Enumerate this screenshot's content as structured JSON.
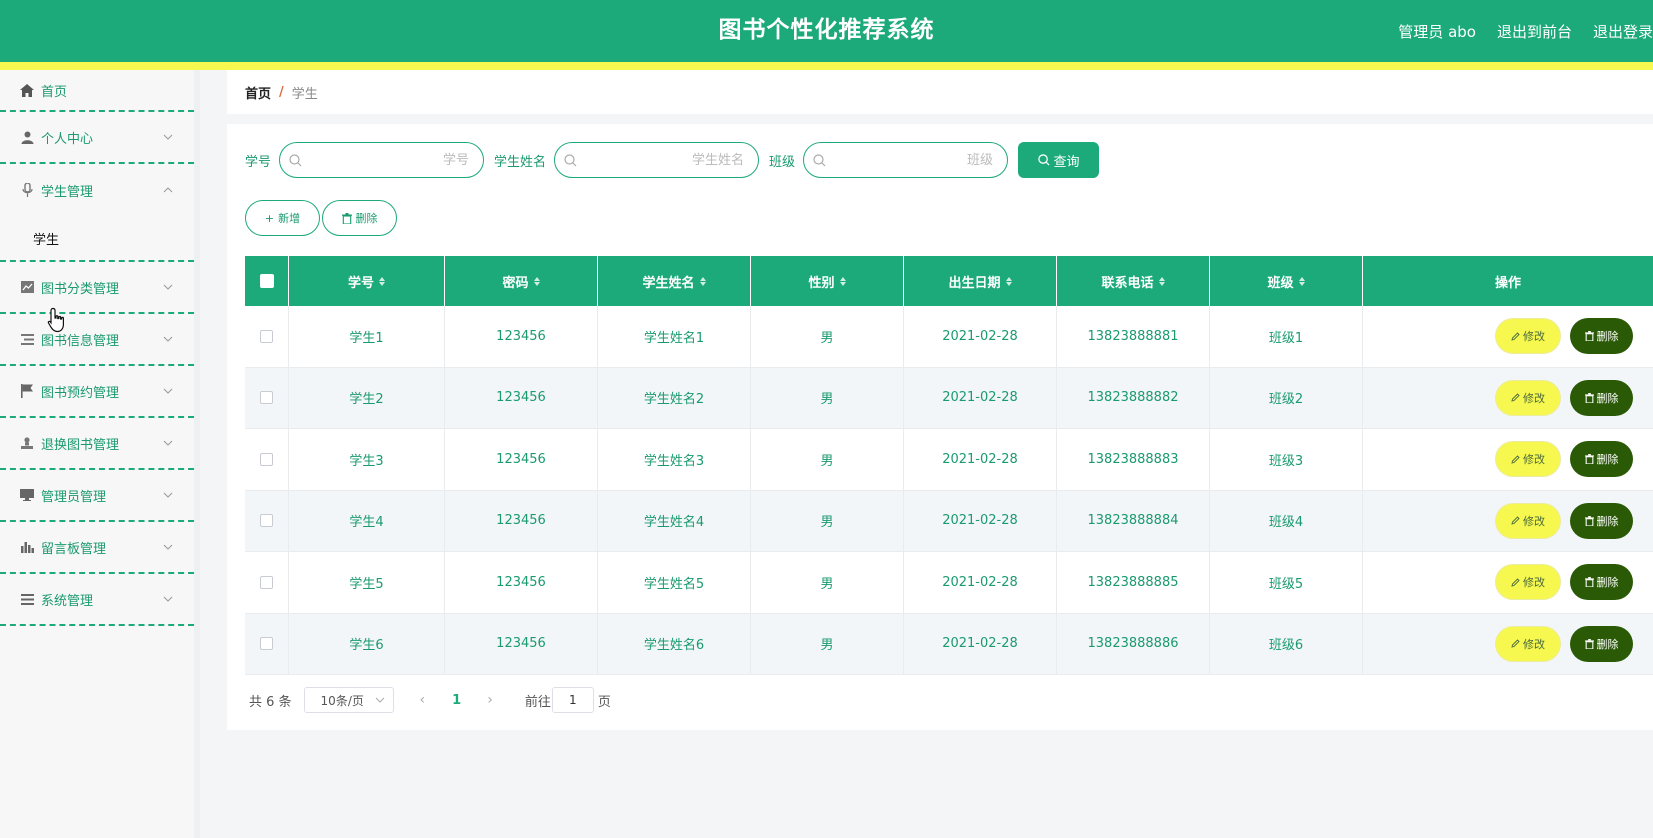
{
  "header": {
    "title": "图书个性化推荐系统",
    "user": "管理员 abo",
    "front_link": "退出到前台",
    "logout_link": "退出登录"
  },
  "colors": {
    "primary": "#1caa7a",
    "accent_yellow": "#f7f84f",
    "delete_dark": "#2a5a06"
  },
  "sidebar": {
    "home": {
      "label": "首页",
      "icon": "home-icon"
    },
    "groups": [
      {
        "label": "个人中心",
        "icon": "user-icon",
        "open": false
      },
      {
        "label": "学生管理",
        "icon": "mic-icon",
        "open": true,
        "children": [
          "学生"
        ]
      },
      {
        "label": "图书分类管理",
        "icon": "chart-icon",
        "open": false
      },
      {
        "label": "图书信息管理",
        "icon": "list-icon",
        "open": false
      },
      {
        "label": "图书预约管理",
        "icon": "flag-icon",
        "open": false
      },
      {
        "label": "退换图书管理",
        "icon": "person-icon",
        "open": false
      },
      {
        "label": "管理员管理",
        "icon": "monitor-icon",
        "open": false
      },
      {
        "label": "留言板管理",
        "icon": "bar-chart-icon",
        "open": false
      },
      {
        "label": "系统管理",
        "icon": "menu-icon",
        "open": false
      }
    ]
  },
  "breadcrumb": {
    "home": "首页",
    "separator": "/",
    "current": "学生"
  },
  "search": {
    "fields": [
      {
        "label": "学号",
        "placeholder": "学号",
        "value": ""
      },
      {
        "label": "学生姓名",
        "placeholder": "学生姓名",
        "value": ""
      },
      {
        "label": "班级",
        "placeholder": "班级",
        "value": ""
      }
    ],
    "query_button": "查询"
  },
  "actions": {
    "add": "新增",
    "delete": "删除"
  },
  "table": {
    "columns": [
      "学号",
      "密码",
      "学生姓名",
      "性别",
      "出生日期",
      "联系电话",
      "班级",
      "操作"
    ],
    "rows": [
      {
        "id": "学生1",
        "password": "123456",
        "name": "学生姓名1",
        "gender": "男",
        "birth": "2021-02-28",
        "phone": "13823888881",
        "class": "班级1"
      },
      {
        "id": "学生2",
        "password": "123456",
        "name": "学生姓名2",
        "gender": "男",
        "birth": "2021-02-28",
        "phone": "13823888882",
        "class": "班级2"
      },
      {
        "id": "学生3",
        "password": "123456",
        "name": "学生姓名3",
        "gender": "男",
        "birth": "2021-02-28",
        "phone": "13823888883",
        "class": "班级3"
      },
      {
        "id": "学生4",
        "password": "123456",
        "name": "学生姓名4",
        "gender": "男",
        "birth": "2021-02-28",
        "phone": "13823888884",
        "class": "班级4"
      },
      {
        "id": "学生5",
        "password": "123456",
        "name": "学生姓名5",
        "gender": "男",
        "birth": "2021-02-28",
        "phone": "13823888885",
        "class": "班级5"
      },
      {
        "id": "学生6",
        "password": "123456",
        "name": "学生姓名6",
        "gender": "男",
        "birth": "2021-02-28",
        "phone": "13823888886",
        "class": "班级6"
      }
    ],
    "edit_label": "修改",
    "delete_label": "删除"
  },
  "pagination": {
    "total_text": "共 6 条",
    "page_size": "10条/页",
    "current_page": "1",
    "goto_label": "前往",
    "goto_value": "1",
    "page_suffix": "页"
  }
}
